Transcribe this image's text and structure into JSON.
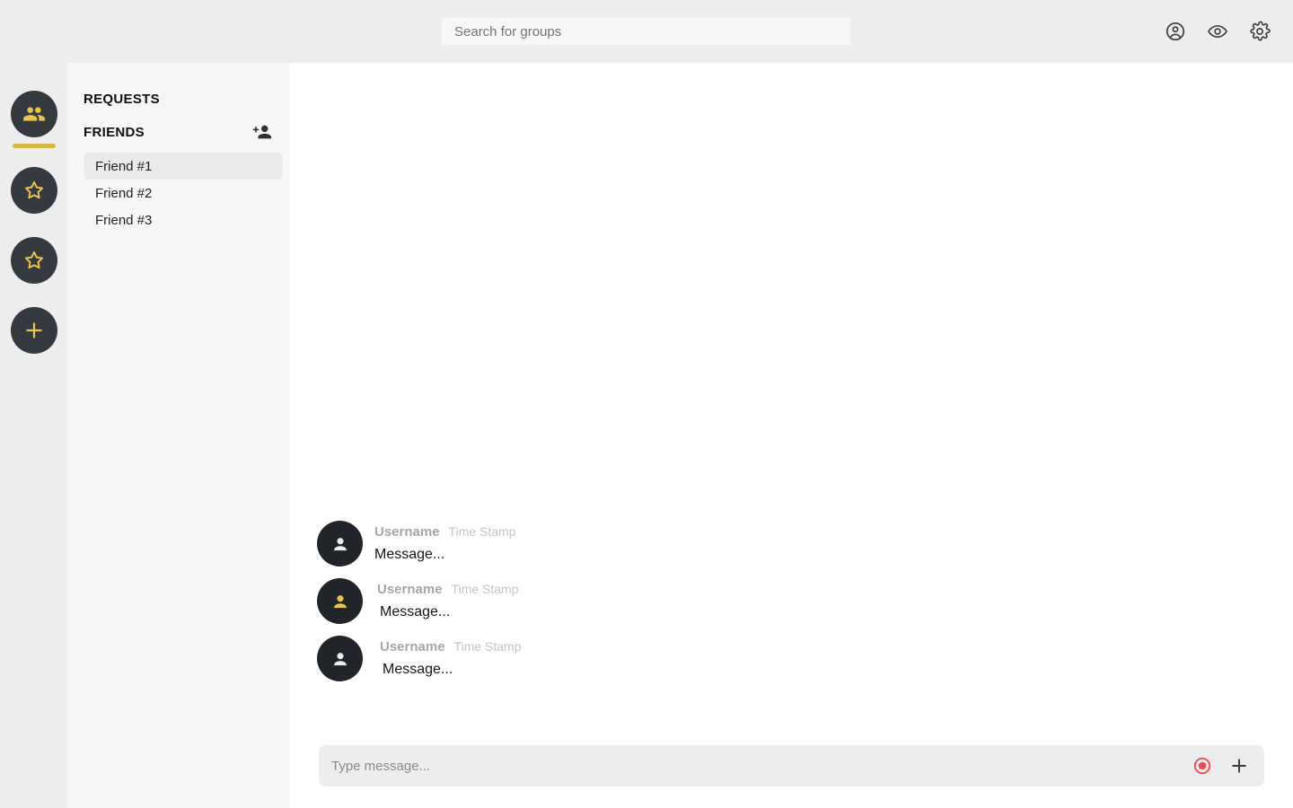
{
  "app": {
    "accent_color": "#e8c44d",
    "rail_bg": "#343a40",
    "panel_bg": "#f7f7f7",
    "chat_bg": "#ffffff",
    "header_bg": "#ededed",
    "record_color": "#ef4a4a"
  },
  "header": {
    "search": {
      "placeholder": "Search for groups",
      "value": ""
    },
    "actions": [
      {
        "name": "account-circle-icon",
        "label": "Account"
      },
      {
        "name": "eye-icon",
        "label": "Visibility"
      },
      {
        "name": "gear-icon",
        "label": "Settings"
      }
    ]
  },
  "rail": {
    "items": [
      {
        "icon": "group-icon",
        "label": "Groups",
        "active": true
      },
      {
        "icon": "star-icon",
        "label": "Favorites 1",
        "active": false
      },
      {
        "icon": "star-icon",
        "label": "Favorites 2",
        "active": false
      },
      {
        "icon": "plus-icon",
        "label": "Add",
        "active": false
      }
    ]
  },
  "sidebar": {
    "requests_label": "REQUESTS",
    "friends_label": "FRIENDS",
    "add_friend_icon": "person-add-icon",
    "friends": [
      {
        "name": "Friend #1",
        "active": true
      },
      {
        "name": "Friend #2",
        "active": false
      },
      {
        "name": "Friend #3",
        "active": false
      }
    ]
  },
  "chat": {
    "messages": [
      {
        "username": "Username",
        "timestamp": "Time Stamp",
        "text": "Message...",
        "avatar_accent": false
      },
      {
        "username": "Username",
        "timestamp": "Time Stamp",
        "text": "Message...",
        "avatar_accent": true
      },
      {
        "username": "Username",
        "timestamp": "Time Stamp",
        "text": "Message...",
        "avatar_accent": false
      }
    ],
    "composer": {
      "placeholder": "Type message...",
      "value": "",
      "record_icon": "record-icon",
      "attach_icon": "plus-icon"
    }
  }
}
